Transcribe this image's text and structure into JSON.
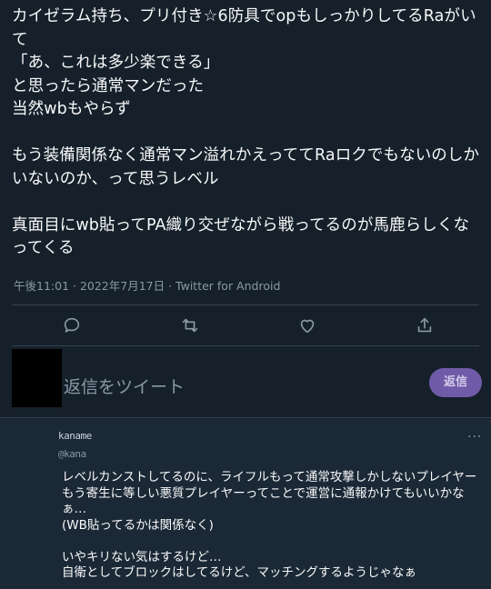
{
  "tweet": {
    "text": "カイゼラム持ち、プリ付き☆6防具でopもしっかりしてるRaがいて\n「あ、これは多少楽できる」\nと思ったら通常マンだった\n当然wbもやらず\n\nもう装備関係なく通常マン溢れかえっててRaロクでもないのしかいないのか、って思うレベル\n\n真面目にwb貼ってPA織り交ぜながら戦ってるのが馬鹿らしくなってくる",
    "timestamp": "午後11:01 · 2022年7月17日 · Twitter for Android"
  },
  "actions": {
    "icons": [
      "reply-icon",
      "retweet-icon",
      "like-icon",
      "share-icon"
    ]
  },
  "reply_box": {
    "placeholder": "返信をツイート",
    "button_label": "返信"
  },
  "reply": {
    "name": "kaname",
    "handle": "@kana",
    "more": "···",
    "text": "レベルカンストしてるのに、ライフルもって通常攻撃しかしないプレイヤーもう寄生に等しい悪質プレイヤーってことで運営に通報かけてもいいかなぁ…\n(WB貼ってるかは関係なく)\n\nいやキリない気はするけど…\n自衛としてブロックはしてるけど、マッチングするようじゃなぁ"
  },
  "colors": {
    "background": "#15202b",
    "reply_background": "#1b2836",
    "muted": "#8b98a5",
    "accent": "#6f5ba8"
  }
}
